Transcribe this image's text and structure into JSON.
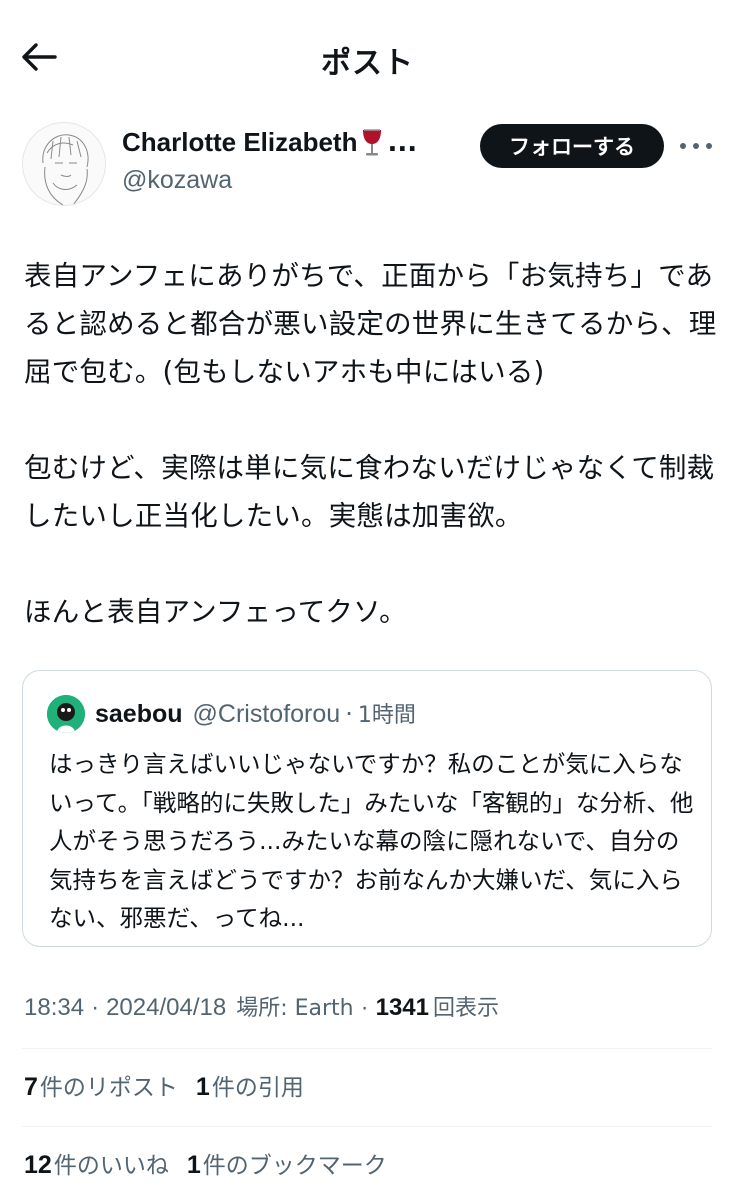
{
  "header": {
    "title": "ポスト"
  },
  "author": {
    "name": "Charlotte Elizabeth",
    "emoji": "wine-glass-icon",
    "truncation": "...",
    "handle": "@kozawa",
    "follow_label": "フォローする"
  },
  "post": {
    "text": "表自アンフェにありがちで、正面から「お気持ち」であると認めると都合が悪い設定の世界に生きてるから、理屈で包む。(包もしないアホも中にはいる)\n\n包むけど、実際は単に気に食わないだけじゃなくて制裁したいし正当化したい。実態は加害欲。\n\nほんと表自アンフェってクソ。"
  },
  "quote": {
    "name": "saebou",
    "handle": "@Cristoforou",
    "separator": "·",
    "time": "1時間",
    "text": "はっきり言えばいいじゃないですか？私のことが気に入らないって。「戦略的に失敗した」みたいな「客観的」な分析、他人がそう思うだろう...みたいな幕の陰に隠れないで、自分の気持ちを言えばどうですか？お前なんか大嫌いだ、気に入らない、邪悪だ、ってね..."
  },
  "meta": {
    "time": "18:34",
    "date": "2024/04/18",
    "location": "場所: Earth",
    "views_count": "1341",
    "views_label": "回表示",
    "separator": "·"
  },
  "stats": {
    "reposts_count": "7",
    "reposts_label": "件のリポスト",
    "quotes_count": "1",
    "quotes_label": "件の引用",
    "likes_count": "12",
    "likes_label": "件のいいね",
    "bookmarks_count": "1",
    "bookmarks_label": "件のブックマーク"
  },
  "colors": {
    "text": "#0f1419",
    "secondary": "#536471",
    "border": "#cfd9de",
    "follow_bg": "#0f1419"
  }
}
